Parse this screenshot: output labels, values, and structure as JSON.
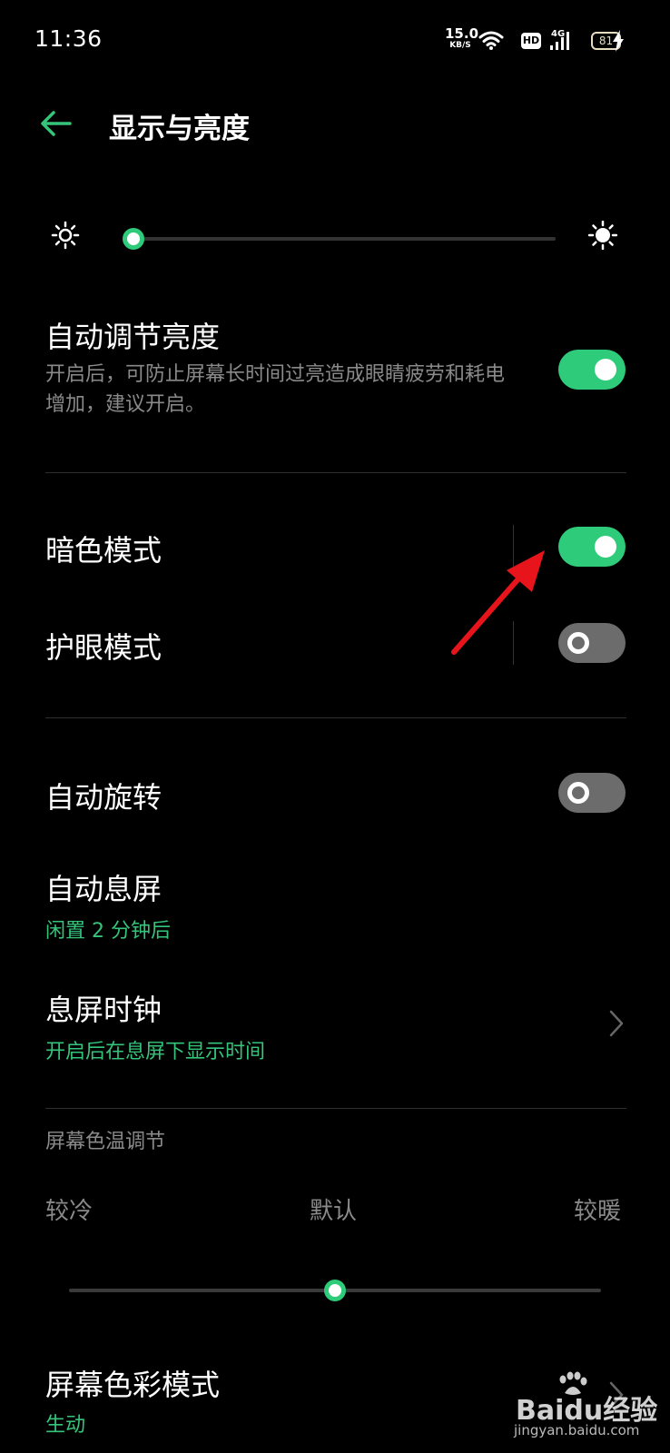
{
  "status_bar": {
    "time": "11:36",
    "net_speed_value": "15.0",
    "net_speed_unit": "KB/S",
    "hd_label": "HD",
    "signal_label": "4G",
    "battery_level": "81"
  },
  "header": {
    "title": "显示与亮度"
  },
  "brightness": {
    "level": 0.02
  },
  "auto_brightness": {
    "title": "自动调节亮度",
    "description": "开启后，可防止屏幕长时间过亮造成眼睛疲劳和耗电增加，建议开启。",
    "enabled": true
  },
  "dark_mode": {
    "title": "暗色模式",
    "enabled": true
  },
  "eye_comfort": {
    "title": "护眼模式",
    "enabled": false
  },
  "auto_rotate": {
    "title": "自动旋转",
    "enabled": false
  },
  "screen_timeout": {
    "title": "自动息屏",
    "value": "闲置 2 分钟后"
  },
  "aod_clock": {
    "title": "息屏时钟",
    "description": "开启后在息屏下显示时间"
  },
  "color_temperature": {
    "section_title": "屏幕色温调节",
    "cool_label": "较冷",
    "default_label": "默认",
    "warm_label": "较暖",
    "level": 0.5
  },
  "color_mode": {
    "title": "屏幕色彩模式",
    "value": "生动"
  },
  "watermark": {
    "brand": "Baidu经验",
    "url": "jingyan.baidu.com"
  },
  "colors": {
    "accent": "#2ecc7a",
    "arrow": "#e8141b"
  }
}
